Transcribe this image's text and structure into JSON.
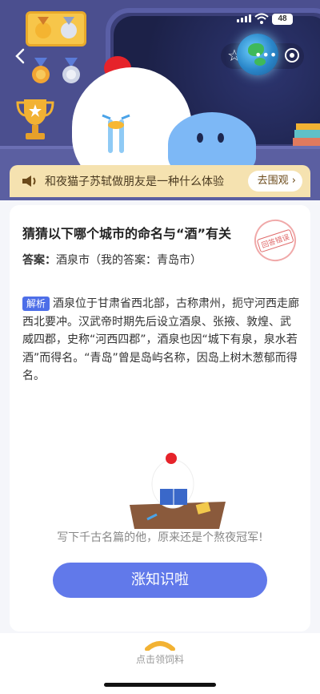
{
  "status": {
    "battery": "48"
  },
  "notice": {
    "text": "和夜猫子苏轼做朋友是一种什么体验",
    "button": "去围观"
  },
  "question": {
    "title": "猜猜以下哪个城市的命名与“酒”有关",
    "answer_label": "答案：",
    "answer_value": "酒泉市（我的答案：青岛市）",
    "stamp": "回答错误"
  },
  "analysis": {
    "tag": "解析",
    "text": "酒泉位于甘肃省西北部，古称肃州，扼守河西走廊西北要冲。汉武帝时期先后设立酒泉、张掖、敦煌、武威四郡，史称“河西四郡”，酒泉也因“城下有泉，泉水若酒”而得名。“青岛”曾是岛屿名称，因岛上树木葱郁而得名。"
  },
  "caption": "写下千古名篇的他，原来还是个熬夜冠军!",
  "cta": "涨知识啦",
  "bottom": {
    "feed_label": "点击领饲料"
  },
  "colors": {
    "accent": "#6179ea",
    "header": "#4b4f8f",
    "notice": "#f5e2b0"
  },
  "icons": [
    "back-arrow-icon",
    "star-icon",
    "more-icon",
    "target-icon",
    "speaker-icon",
    "chevron-right-icon"
  ]
}
